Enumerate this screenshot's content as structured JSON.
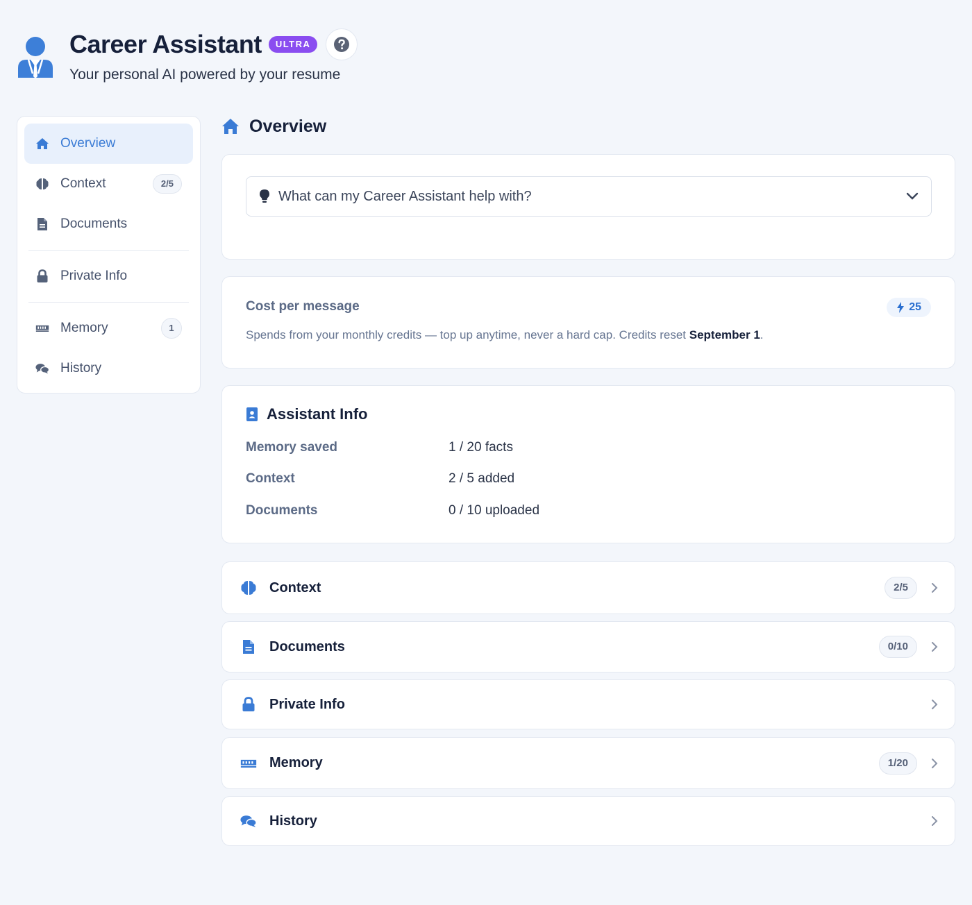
{
  "header": {
    "title": "Career Assistant",
    "badge": "ULTRA",
    "subtitle": "Your personal AI powered by your resume"
  },
  "sidebar": {
    "items": [
      {
        "label": "Overview",
        "icon": "home-icon",
        "active": true
      },
      {
        "label": "Context",
        "icon": "brain-icon",
        "badge": "2/5"
      },
      {
        "label": "Documents",
        "icon": "document-icon"
      },
      {
        "label": "Private Info",
        "icon": "lock-icon"
      },
      {
        "label": "Memory",
        "icon": "memory-icon",
        "badge": "1"
      },
      {
        "label": "History",
        "icon": "chat-icon"
      }
    ]
  },
  "main": {
    "title": "Overview",
    "help_dropdown": {
      "label": "What can my Career Assistant help with?"
    },
    "cost": {
      "title": "Cost per message",
      "credits": "25",
      "description": "Spends from your monthly credits — top up anytime, never a hard cap. Credits reset ",
      "reset_date": "September 1",
      "period": "."
    },
    "info": {
      "title": "Assistant Info",
      "rows": [
        {
          "key": "Memory saved",
          "value": "1 / 20 facts"
        },
        {
          "key": "Context",
          "value": "2 / 5 added"
        },
        {
          "key": "Documents",
          "value": "0 / 10 uploaded"
        }
      ]
    },
    "links": [
      {
        "label": "Context",
        "icon": "brain-icon",
        "badge": "2/5"
      },
      {
        "label": "Documents",
        "icon": "document-icon",
        "badge": "0/10"
      },
      {
        "label": "Private Info",
        "icon": "lock-icon"
      },
      {
        "label": "Memory",
        "icon": "memory-icon",
        "badge": "1/20"
      },
      {
        "label": "History",
        "icon": "chat-icon"
      }
    ]
  },
  "colors": {
    "accent": "#3a7bd5",
    "badge": "#8a4df0",
    "background": "#f3f6fb"
  }
}
